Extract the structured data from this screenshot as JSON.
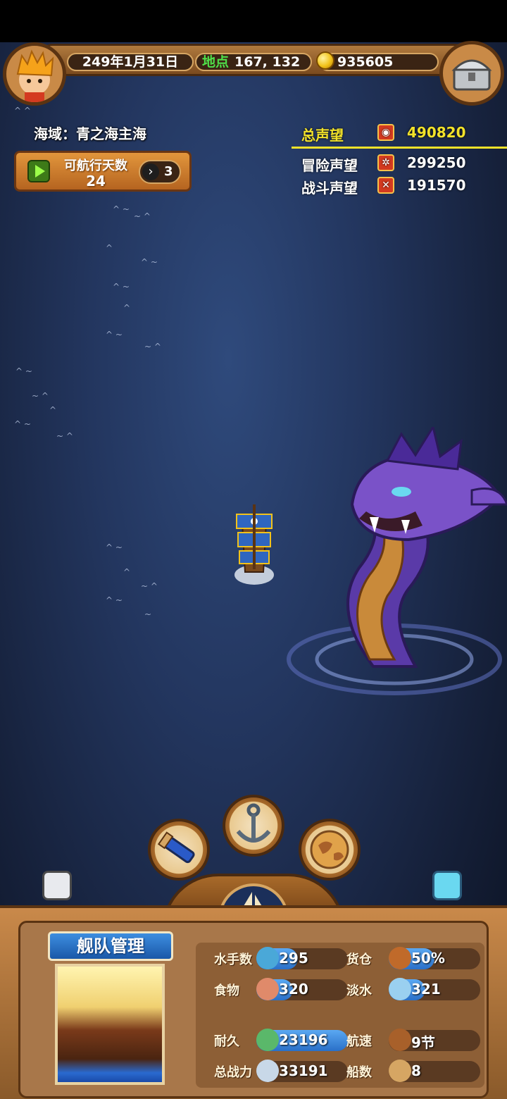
{
  "header": {
    "date": "249年1月31日",
    "location_label": "地点",
    "location_value": "167, 132",
    "gold": "935605"
  },
  "region": {
    "text": "海域：青之海主海"
  },
  "sailing": {
    "label": "可航行天数",
    "days": "24",
    "next_count": "3"
  },
  "reputation": {
    "total_label": "总声望",
    "total_value": "490820",
    "adventure_label": "冒险声望",
    "adventure_value": "299250",
    "combat_label": "战斗声望",
    "combat_value": "191570"
  },
  "fleet": {
    "title": "舰队管理",
    "stats": [
      {
        "label": "水手数",
        "value": "295",
        "icon": "sailor-icon",
        "fill": 0.45
      },
      {
        "label": "货仓",
        "value": "50%",
        "icon": "cargo-icon",
        "fill": 0.5
      },
      {
        "label": "食物",
        "value": "320",
        "icon": "food-icon",
        "fill": 0.4
      },
      {
        "label": "淡水",
        "value": "321",
        "icon": "water-icon",
        "fill": 0.4
      },
      {
        "label": "耐久",
        "value": "23196",
        "icon": "durability-icon",
        "fill": 1.0
      },
      {
        "label": "航速",
        "value": "9节",
        "icon": "speed-icon",
        "fill": 0
      },
      {
        "label": "总战力",
        "value": "33191",
        "icon": "power-icon",
        "fill": 0
      },
      {
        "label": "船数",
        "value": "8",
        "icon": "ship-count-icon",
        "fill": 0
      }
    ]
  },
  "colors": {
    "location_label": "#4fe04a",
    "total_reputation": "#f2e22a",
    "stat_fill": "#3a86dc"
  }
}
